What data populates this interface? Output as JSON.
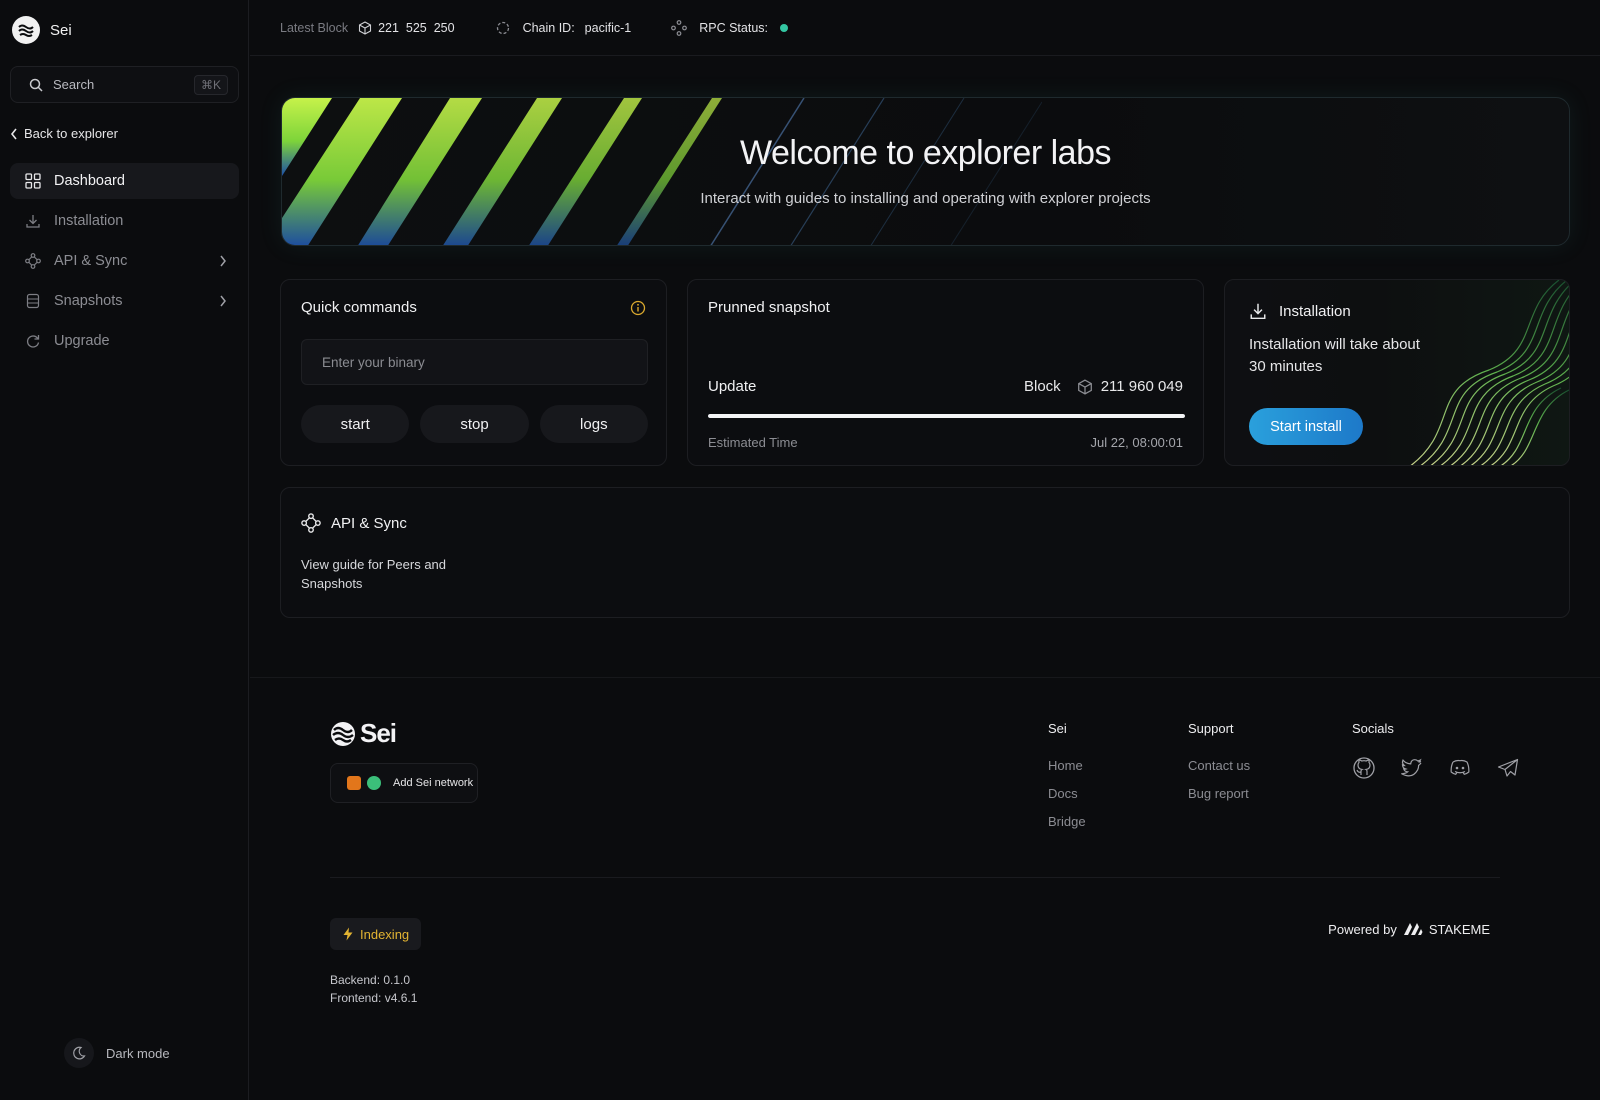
{
  "app": {
    "name": "Sei"
  },
  "sidebar": {
    "search_label": "Search",
    "search_shortcut": "⌘K",
    "back_label": "Back to explorer",
    "items": [
      {
        "label": "Dashboard",
        "icon": "grid-icon",
        "active": true
      },
      {
        "label": "Installation",
        "icon": "download-icon"
      },
      {
        "label": "API & Sync",
        "icon": "nodes-icon",
        "expandable": true
      },
      {
        "label": "Snapshots",
        "icon": "database-icon",
        "expandable": true
      },
      {
        "label": "Upgrade",
        "icon": "refresh-icon"
      }
    ],
    "dark_mode_label": "Dark mode"
  },
  "topbar": {
    "latest_block_label": "Latest Block",
    "latest_block_value": "221  525  250",
    "chain_id_label": "Chain ID:",
    "chain_id_value": "pacific-1",
    "rpc_status_label": "RPC Status:",
    "rpc_status_color": "#34c6a2"
  },
  "hero": {
    "title": "Welcome to explorer labs",
    "subtitle": "Interact with guides to installing and operating with explorer projects"
  },
  "quick_commands": {
    "title": "Quick commands",
    "placeholder": "Enter your binary",
    "buttons": [
      "start",
      "stop",
      "logs"
    ]
  },
  "pruned_snapshot": {
    "title": "Prunned snapshot",
    "update_label": "Update",
    "block_label": "Block",
    "block_value": "211 960 049",
    "progress": 1.0,
    "estimated_label": "Estimated Time",
    "estimated_value": "Jul 22, 08:00:01"
  },
  "installation": {
    "title": "Installation",
    "text": "Installation will take about 30 minutes",
    "button": "Start install",
    "accent": "#2aa0dc"
  },
  "api_sync": {
    "title": "API & Sync",
    "text": "View guide for Peers and Snapshots"
  },
  "footer": {
    "logo_text": "Sei",
    "add_network": "Add Sei network",
    "columns": [
      {
        "title": "Sei",
        "links": [
          "Home",
          "Docs",
          "Bridge"
        ]
      },
      {
        "title": "Support",
        "links": [
          "Contact us",
          "Bug report"
        ]
      }
    ],
    "socials_title": "Socials",
    "socials": [
      "github-icon",
      "twitter-icon",
      "discord-icon",
      "telegram-icon"
    ],
    "indexing": "Indexing",
    "backend": "Backend: 0.1.0",
    "frontend": "Frontend: v4.6.1",
    "powered_by": "Powered by",
    "powered_brand": "STAKEME"
  }
}
